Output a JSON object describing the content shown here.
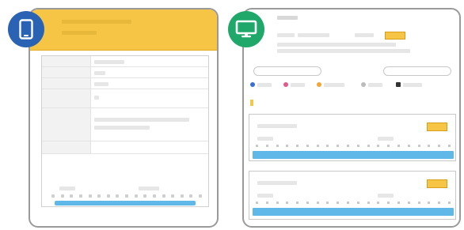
{
  "badges": {
    "phone": {
      "icon": "smartphone-icon",
      "color": "#2a63b3"
    },
    "desktop": {
      "icon": "monitor-icon",
      "color": "#20a86b"
    }
  },
  "colors": {
    "header": "#f6c545",
    "accent_bar": "#5fb8e8"
  }
}
